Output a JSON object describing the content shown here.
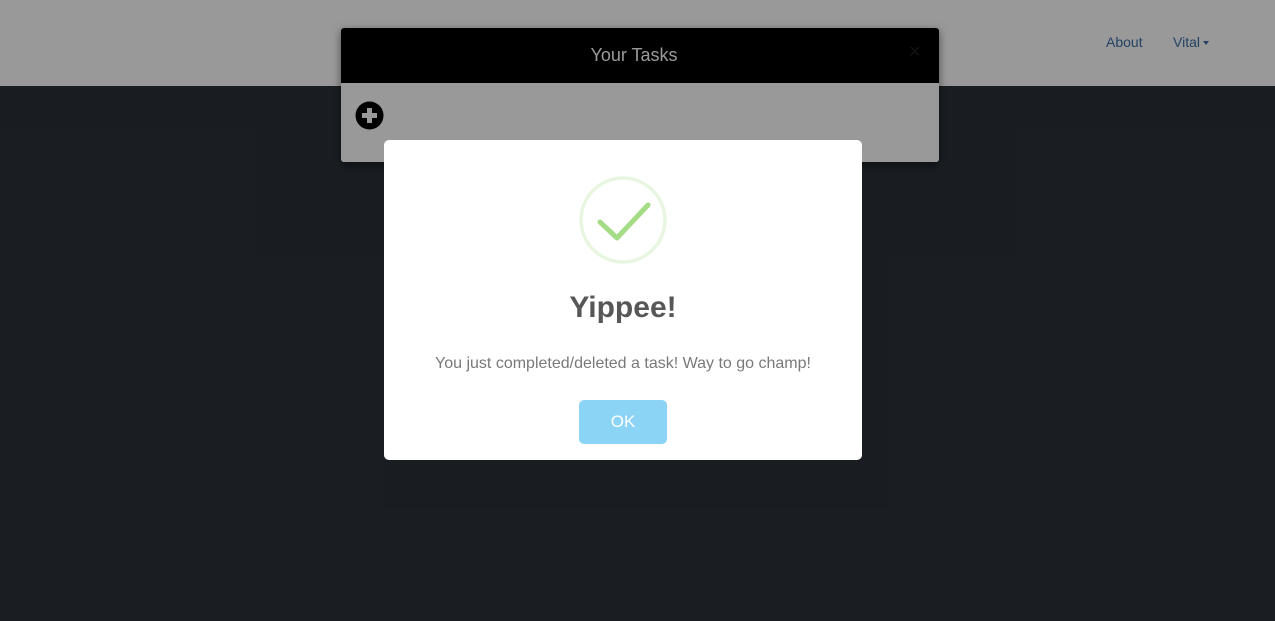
{
  "navbar": {
    "links": [
      {
        "label": "About"
      },
      {
        "label": "Vital",
        "has_dropdown": true
      }
    ]
  },
  "tasks_modal": {
    "title": "Your Tasks",
    "close_symbol": "×",
    "add_icon": "plus-circle-icon"
  },
  "alert": {
    "icon": "checkmark-icon",
    "title": "Yippee!",
    "text": "You just completed/deleted a task! Way to go champ!",
    "confirm_label": "OK",
    "confirm_color": "#8cd4f5",
    "success_color": "#a5dc86"
  }
}
